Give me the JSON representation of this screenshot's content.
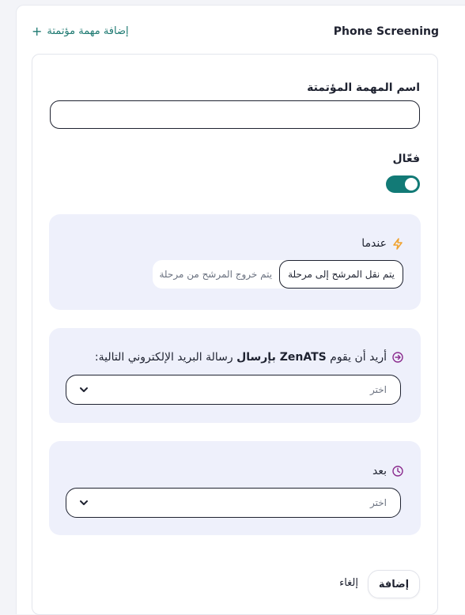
{
  "header": {
    "section_title": "Phone Screening",
    "add_automation_label": "إضافة مهمة مؤتمتة"
  },
  "form": {
    "name_label": "اسم المهمة المؤتمتة",
    "name_value": "",
    "active_label": "فعّال",
    "active": true
  },
  "trigger": {
    "label": "عندما",
    "options": [
      "يتم نقل المرشح إلى مرحلة",
      "يتم خروج المرشح من مرحلة"
    ],
    "selected": "يتم نقل المرشح إلى مرحلة"
  },
  "action": {
    "text_before": "أريد أن يقوم ",
    "text_bold": "ZenATS بإرسال",
    "text_after": " رسالة البريد الإلكتروني التالية:",
    "select_placeholder": "اختر"
  },
  "delay": {
    "label": "بعد",
    "select_placeholder": "اختر"
  },
  "footer": {
    "add_label": "إضافة",
    "cancel_label": "إلغاء"
  },
  "colors": {
    "accent": "#127a76",
    "panel": "#eef0fb",
    "trigger_icon": "#f0a22e",
    "action_icon": "#8b2c8e",
    "delay_icon": "#8b2c8e"
  }
}
